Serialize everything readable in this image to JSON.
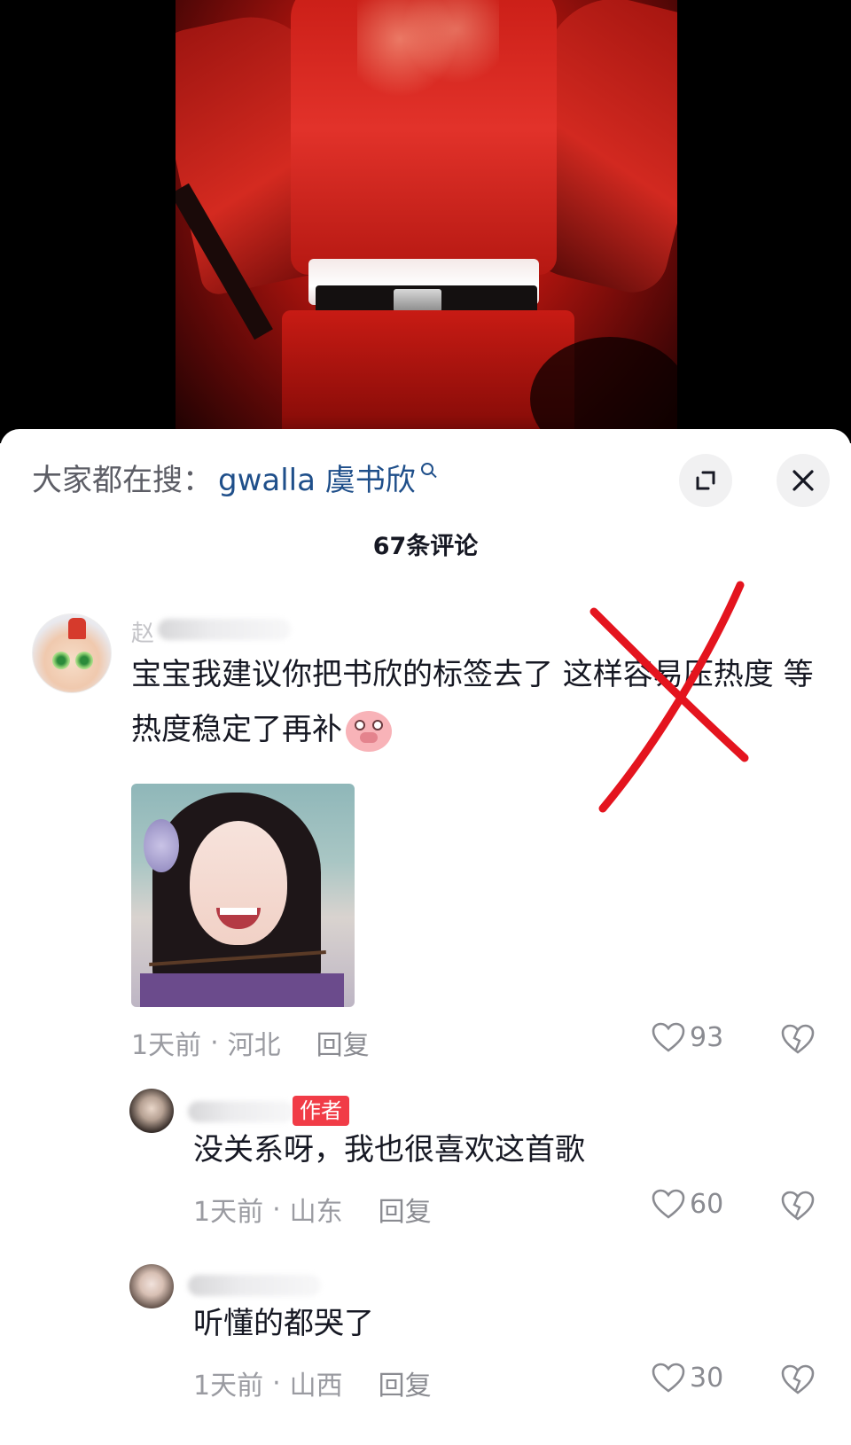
{
  "search": {
    "prefix": "大家都在搜：",
    "term": "gwalla 虞书欣"
  },
  "comment_count": "67条评论",
  "comments": [
    {
      "name_visible": "赵",
      "text": "宝宝我建议你把书欣的标签去了 这样容易压热度 等热度稳定了再补",
      "has_image": true,
      "time": "1天前",
      "location": "河北",
      "reply_label": "回复",
      "likes": "93"
    },
    {
      "badge": "作者",
      "text": "没关系呀，我也很喜欢这首歌",
      "time": "1天前",
      "location": "山东",
      "reply_label": "回复",
      "likes": "60"
    },
    {
      "text": "听懂的都哭了",
      "time": "1天前",
      "location": "山西",
      "reply_label": "回复",
      "likes": "30"
    }
  ],
  "colors": {
    "accent_link": "#1f4f8a",
    "author_badge": "#f13c47",
    "annotation": "#e4141e",
    "meta_text": "#9a9ba1"
  },
  "icons": [
    "search-icon",
    "expand-icon",
    "close-icon",
    "heart-icon",
    "broken-heart-icon",
    "pig-emoji-icon"
  ]
}
